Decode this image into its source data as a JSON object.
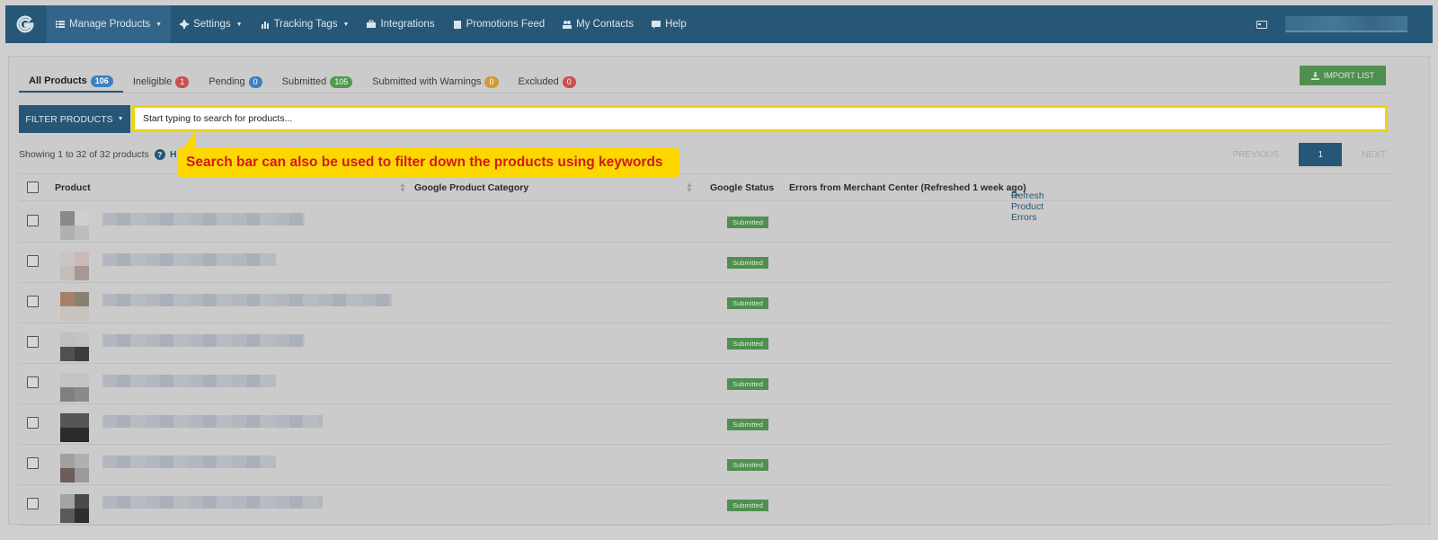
{
  "navbar": {
    "logo_letter": "G",
    "items": [
      {
        "label": "Manage Products",
        "icon": "list-icon",
        "caret": true
      },
      {
        "label": "Settings",
        "icon": "gear-icon",
        "caret": true
      },
      {
        "label": "Tracking Tags",
        "icon": "bar-chart-icon",
        "caret": true
      },
      {
        "label": "Integrations",
        "icon": "briefcase-icon",
        "caret": false
      },
      {
        "label": "Promotions Feed",
        "icon": "clipboard-icon",
        "caret": false
      },
      {
        "label": "My Contacts",
        "icon": "users-icon",
        "caret": false
      },
      {
        "label": "Help",
        "icon": "comment-icon",
        "caret": false
      }
    ],
    "caret_glyph": "▼"
  },
  "tabs": [
    {
      "label": "All Products",
      "count": "106",
      "color": "#3d7fc4"
    },
    {
      "label": "Ineligible",
      "count": "1",
      "color": "#c9514f"
    },
    {
      "label": "Pending",
      "count": "0",
      "color": "#3d7fc4"
    },
    {
      "label": "Submitted",
      "count": "105",
      "color": "#4f9a4f"
    },
    {
      "label": "Submitted with Warnings",
      "count": "0",
      "color": "#d39a34"
    },
    {
      "label": "Excluded",
      "count": "0",
      "color": "#c9514f"
    }
  ],
  "import_button": "IMPORT LIST",
  "filter_button": "FILTER PRODUCTS",
  "search": {
    "placeholder": "Start typing to search for products..."
  },
  "showing": "Showing 1 to 32 of 32 products",
  "help_glyph": "?",
  "hidden_link": "Hi",
  "pagination": {
    "previous": "PREVIOUS",
    "current": "1",
    "next": "NEXT"
  },
  "table": {
    "col_product": "Product",
    "col_category": "Google Product Category",
    "col_status": "Google Status",
    "col_errors": "Errors from Merchant Center (Refreshed 1 week ago)",
    "refresh_link": "Refresh Product Errors",
    "status_label": "Submitted",
    "rows": [
      {
        "thumb": [
          "#8a8a8a",
          "#cfcfcf",
          "#b0b0b0",
          "#bdbdbd"
        ],
        "name_fraction": 0.7
      },
      {
        "thumb": [
          "#c9c5c2",
          "#cdb9b4",
          "#c2bdb8",
          "#a89896"
        ],
        "name_fraction": 0.6
      },
      {
        "thumb": [
          "#a88068",
          "#8a8070",
          "#c8c3be",
          "#c7c3bf"
        ],
        "name_fraction": 1.0
      },
      {
        "thumb": [
          "#c0c0c0",
          "#c3c3c3",
          "#505050",
          "#3d3d3d"
        ],
        "name_fraction": 0.7
      },
      {
        "thumb": [
          "#c4c4c4",
          "#c4c4c4",
          "#808080",
          "#8a8a8a"
        ],
        "name_fraction": 0.6
      },
      {
        "thumb": [
          "#555555",
          "#555555",
          "#2a2a2a",
          "#2a2a2a"
        ],
        "name_fraction": 0.76
      },
      {
        "thumb": [
          "#a0a0a0",
          "#b0b0b0",
          "#6b5d58",
          "#9a9a9a"
        ],
        "name_fraction": 0.6
      },
      {
        "thumb": [
          "#a4a4a4",
          "#4a4a4a",
          "#5a5a5a",
          "#2e2e2e"
        ],
        "name_fraction": 0.76
      }
    ]
  },
  "callout": "Search bar can also be used to filter down the products using keywords"
}
